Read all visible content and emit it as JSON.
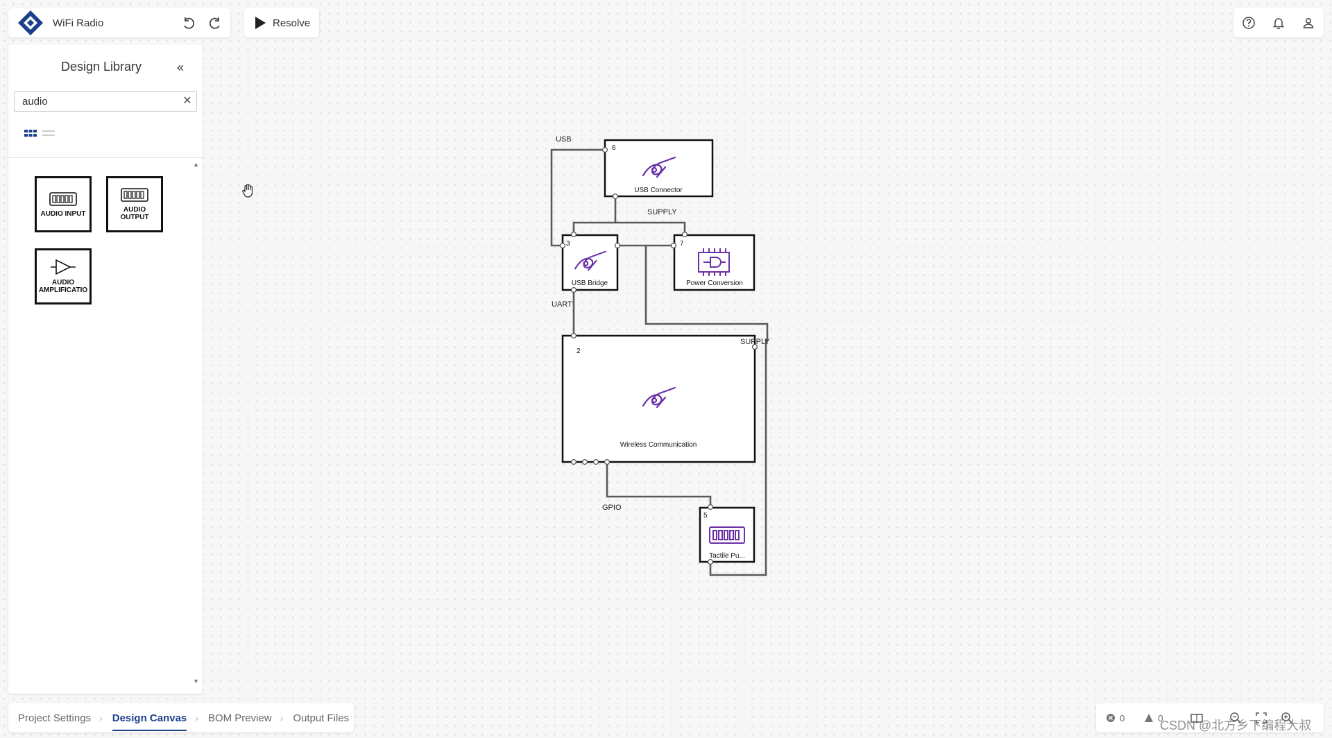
{
  "app": {
    "title": "WiFi Radio"
  },
  "toolbar": {
    "undo_icon": "undo-icon",
    "redo_icon": "redo-icon",
    "resolve_label": "Resolve"
  },
  "topright_icons": [
    "help-icon",
    "bell-icon",
    "user-icon"
  ],
  "sidebar": {
    "title": "Design Library",
    "search": {
      "value": "audio",
      "placeholder": ""
    },
    "view_modes": [
      "grid-view-icon",
      "list-view-icon"
    ],
    "items": [
      {
        "label": "AUDIO INPUT",
        "icon": "connector-icon"
      },
      {
        "label": "AUDIO\nOUTPUT",
        "icon": "connector-icon"
      },
      {
        "label": "AUDIO\nAMPLIFICATIO",
        "icon": "amplifier-icon"
      }
    ]
  },
  "canvas": {
    "blocks": [
      {
        "id": "6",
        "label": "USB Connector",
        "icon": "wireless-icon"
      },
      {
        "id": "3",
        "label": "USB Bridge",
        "icon": "wireless-icon"
      },
      {
        "id": "7",
        "label": "Power Conversion",
        "icon": "chip-icon"
      },
      {
        "id": "2",
        "label": "Wireless Communication",
        "icon": "wireless-icon"
      },
      {
        "id": "5",
        "label": "Tactile Pu...",
        "icon": "connector-icon"
      }
    ],
    "net_labels": {
      "usb": "USB",
      "supply_top": "SUPPLY",
      "uart": "UART",
      "supply_right": "SUPPLY",
      "gpio": "GPIO"
    }
  },
  "bottom_nav": {
    "tabs": [
      "Project Settings",
      "Design Canvas",
      "BOM Preview",
      "Output Files"
    ],
    "active": "Design Canvas"
  },
  "status": {
    "errors": "0",
    "warnings": "0"
  },
  "watermark": "CSDN @北方乡下编程大叔",
  "colors": {
    "accent": "#1c3f8c",
    "icon_purple": "#6b2fa8",
    "wire": "#555555"
  }
}
